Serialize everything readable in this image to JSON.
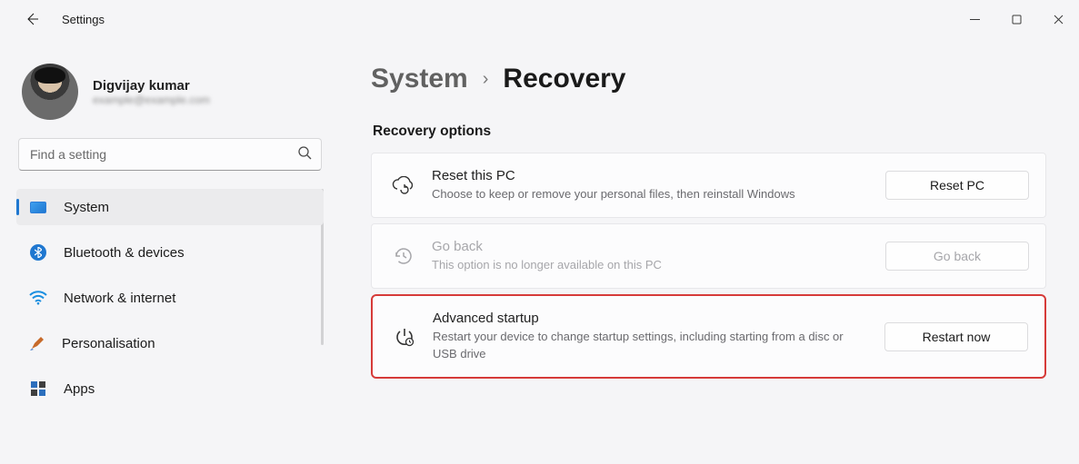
{
  "window": {
    "title": "Settings"
  },
  "profile": {
    "name": "Digvijay kumar",
    "email": "example@example.com"
  },
  "search": {
    "placeholder": "Find a setting"
  },
  "nav": [
    {
      "key": "system",
      "label": "System",
      "active": true
    },
    {
      "key": "bluetooth",
      "label": "Bluetooth & devices"
    },
    {
      "key": "network",
      "label": "Network & internet"
    },
    {
      "key": "personalisation",
      "label": "Personalisation"
    },
    {
      "key": "apps",
      "label": "Apps"
    }
  ],
  "breadcrumb": {
    "parent": "System",
    "current": "Recovery"
  },
  "section_title": "Recovery options",
  "cards": {
    "reset": {
      "title": "Reset this PC",
      "desc": "Choose to keep or remove your personal files, then reinstall Windows",
      "button": "Reset PC"
    },
    "goback": {
      "title": "Go back",
      "desc": "This option is no longer available on this PC",
      "button": "Go back"
    },
    "advanced": {
      "title": "Advanced startup",
      "desc": "Restart your device to change startup settings, including starting from a disc or USB drive",
      "button": "Restart now"
    }
  }
}
